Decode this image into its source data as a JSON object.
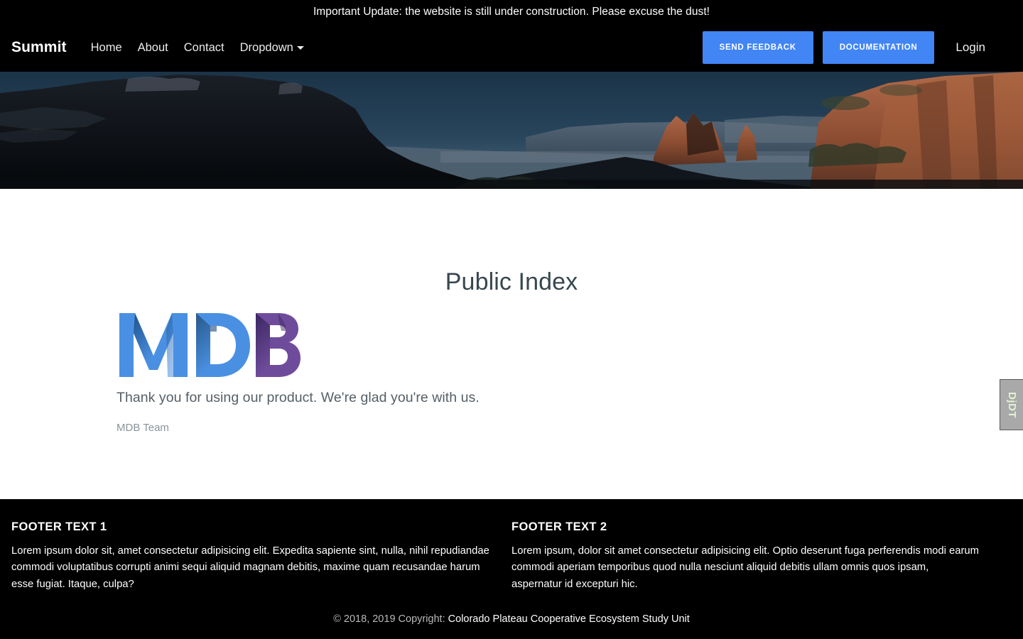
{
  "announcement": {
    "text": "Important Update: the website is still under construction. Please excuse the dust!"
  },
  "navbar": {
    "brand": "Summit",
    "links": [
      {
        "label": "Home"
      },
      {
        "label": "About"
      },
      {
        "label": "Contact"
      },
      {
        "label": "Dropdown",
        "has_caret": true
      }
    ],
    "actions": [
      {
        "label": "SEND FEEDBACK",
        "color": "#4285f4"
      },
      {
        "label": "DOCUMENTATION",
        "color": "#4285f4"
      }
    ],
    "login_label": "Login"
  },
  "hero": {
    "alt": "Red rock canyon landscape with mesa and distant mountains",
    "sky_color": "#20384d",
    "rock_color": "#9c5338"
  },
  "main": {
    "title": "Public Index",
    "logo": {
      "text": "MDB",
      "blue": "#4285f4",
      "blue_light": "#4a90e2",
      "purple": "#5b3a8e",
      "purple_light": "#6f4c9b"
    },
    "lead": "Thank you for using our product. We're glad you're with us.",
    "signature": "MDB Team"
  },
  "footer": {
    "columns": [
      {
        "heading": "Footer text 1",
        "body": "Lorem ipsum dolor sit, amet consectetur adipisicing elit. Expedita sapiente sint, nulla, nihil repudiandae commodi voluptatibus corrupti animi sequi aliquid magnam debitis, maxime quam recusandae harum esse fugiat. Itaque, culpa?"
      },
      {
        "heading": "Footer text 2",
        "body": "Lorem ipsum, dolor sit amet consectetur adipisicing elit. Optio deserunt fuga perferendis modi earum commodi aperiam temporibus quod nulla nesciunt aliquid debitis ullam omnis quos ipsam, aspernatur id excepturi hic."
      }
    ],
    "copyright_prefix": "© 2018, 2019 Copyright:",
    "copyright_org": "Colorado Plateau Cooperative Ecosystem Study Unit"
  },
  "debug_toolbar": {
    "label": "DjDT"
  }
}
